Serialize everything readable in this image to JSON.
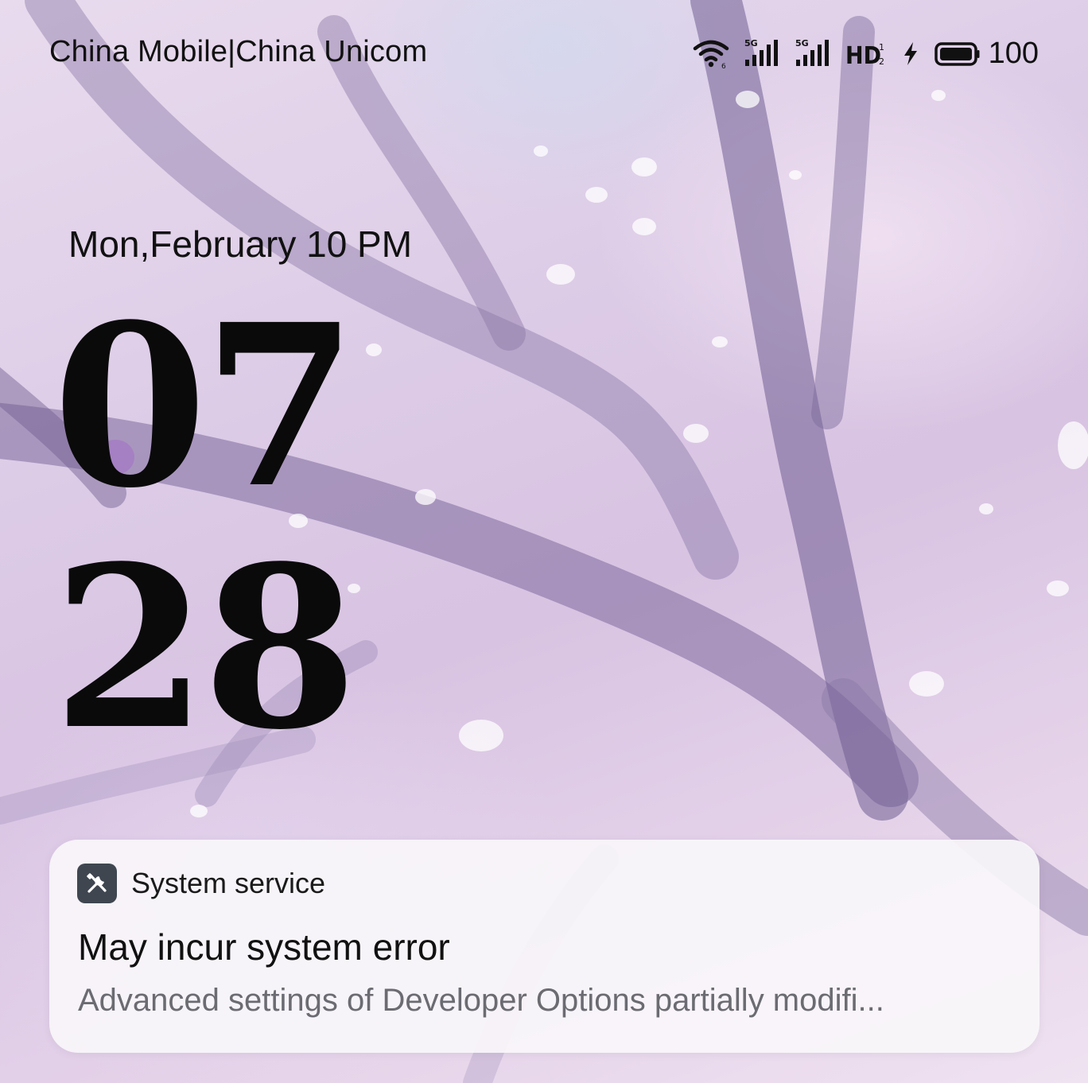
{
  "status_bar": {
    "carrier": "China Mobile|China Unicom",
    "battery_level": "100",
    "icons": [
      "wifi-icon",
      "signal-5g-icon-sim1",
      "signal-5g-icon-sim2",
      "hd-voice-icon",
      "charging-icon",
      "battery-icon"
    ],
    "signal_label_1": "5G",
    "signal_label_2": "5G",
    "hd_label": "HD"
  },
  "lock_screen": {
    "date": "Mon,February 10 PM",
    "hours": "07",
    "minutes": "28"
  },
  "notification": {
    "app_icon": "tools-icon",
    "app_name": "System service",
    "title": "May incur system error",
    "body": "Advanced settings of Developer Options partially modifi..."
  },
  "colors": {
    "wallpaper_base": "#dccbe6",
    "notification_bg": "#f8f6fa",
    "app_icon_bg": "#3f4650",
    "body_text": "#6b6b72"
  }
}
